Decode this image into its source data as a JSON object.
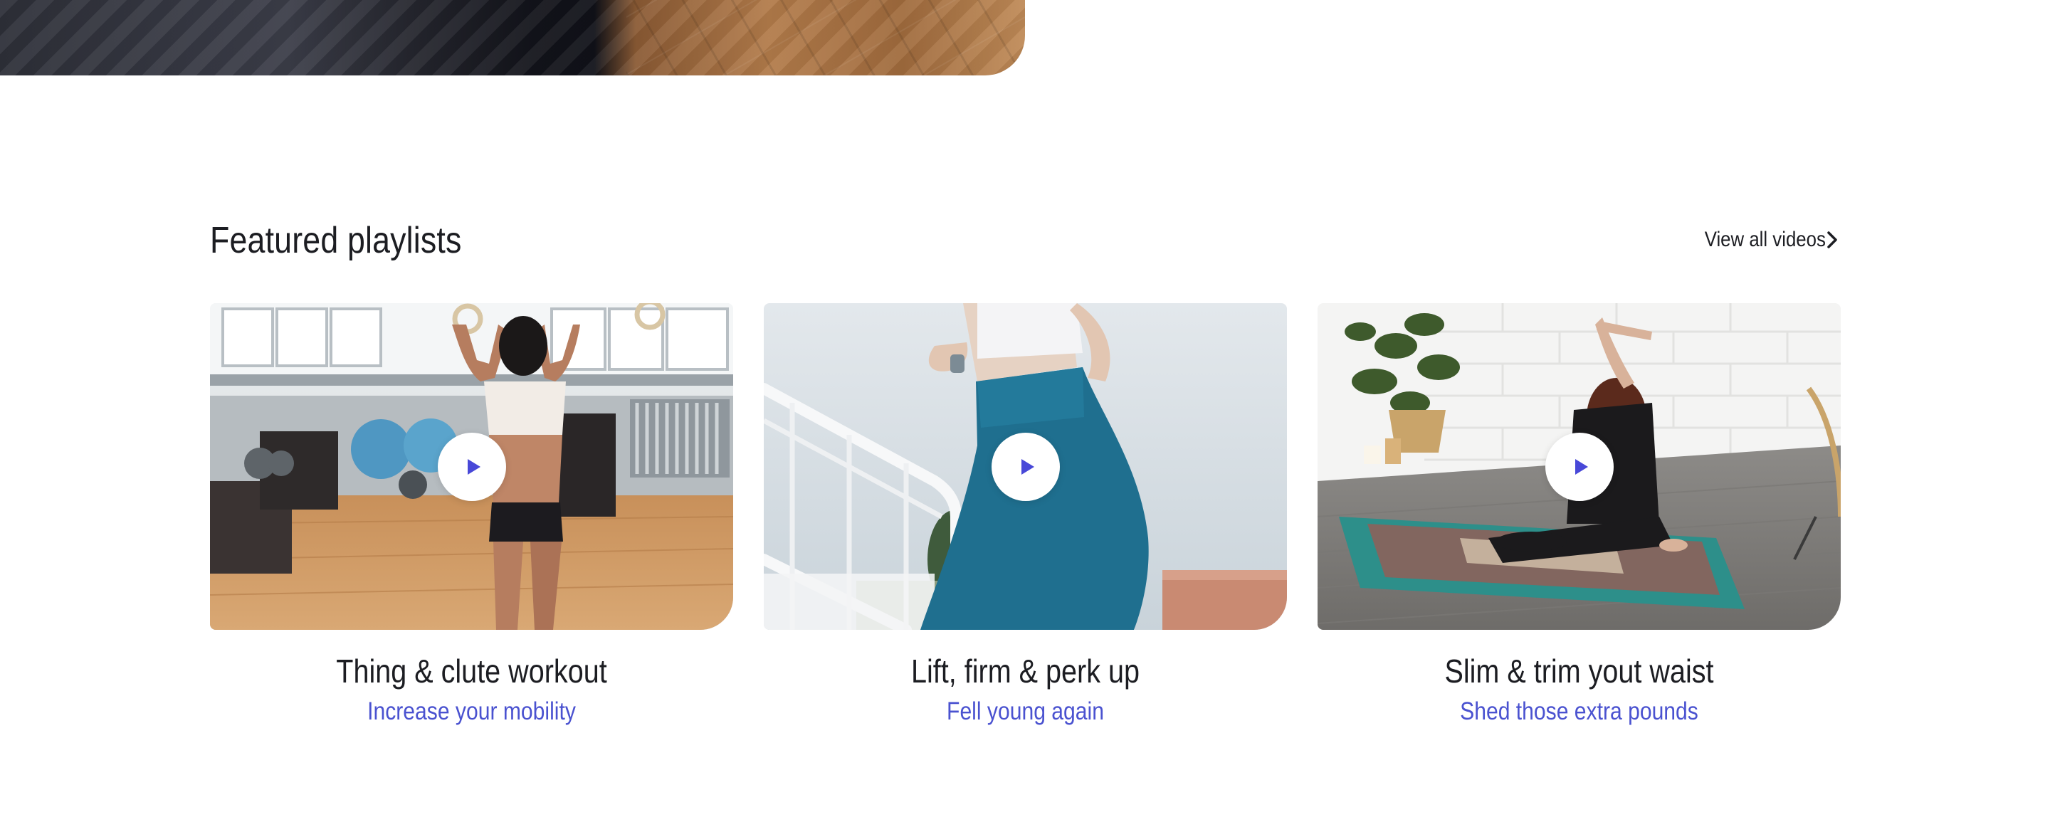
{
  "featured": {
    "title": "Featured playlists",
    "view_all_label": "View all videos",
    "playlists": [
      {
        "title": "Thing & clute workout",
        "subtitle": "Increase your mobility"
      },
      {
        "title": "Lift, firm & perk up",
        "subtitle": "Fell young again"
      },
      {
        "title": "Slim & trim yout waist",
        "subtitle": "Shed those extra pounds"
      }
    ]
  },
  "icons": {
    "view_all": "chevron-right-icon",
    "play": "play-icon"
  },
  "colors": {
    "accent": "#4a52d0",
    "play_icon": "#4848d8",
    "text": "#1c1d22"
  }
}
